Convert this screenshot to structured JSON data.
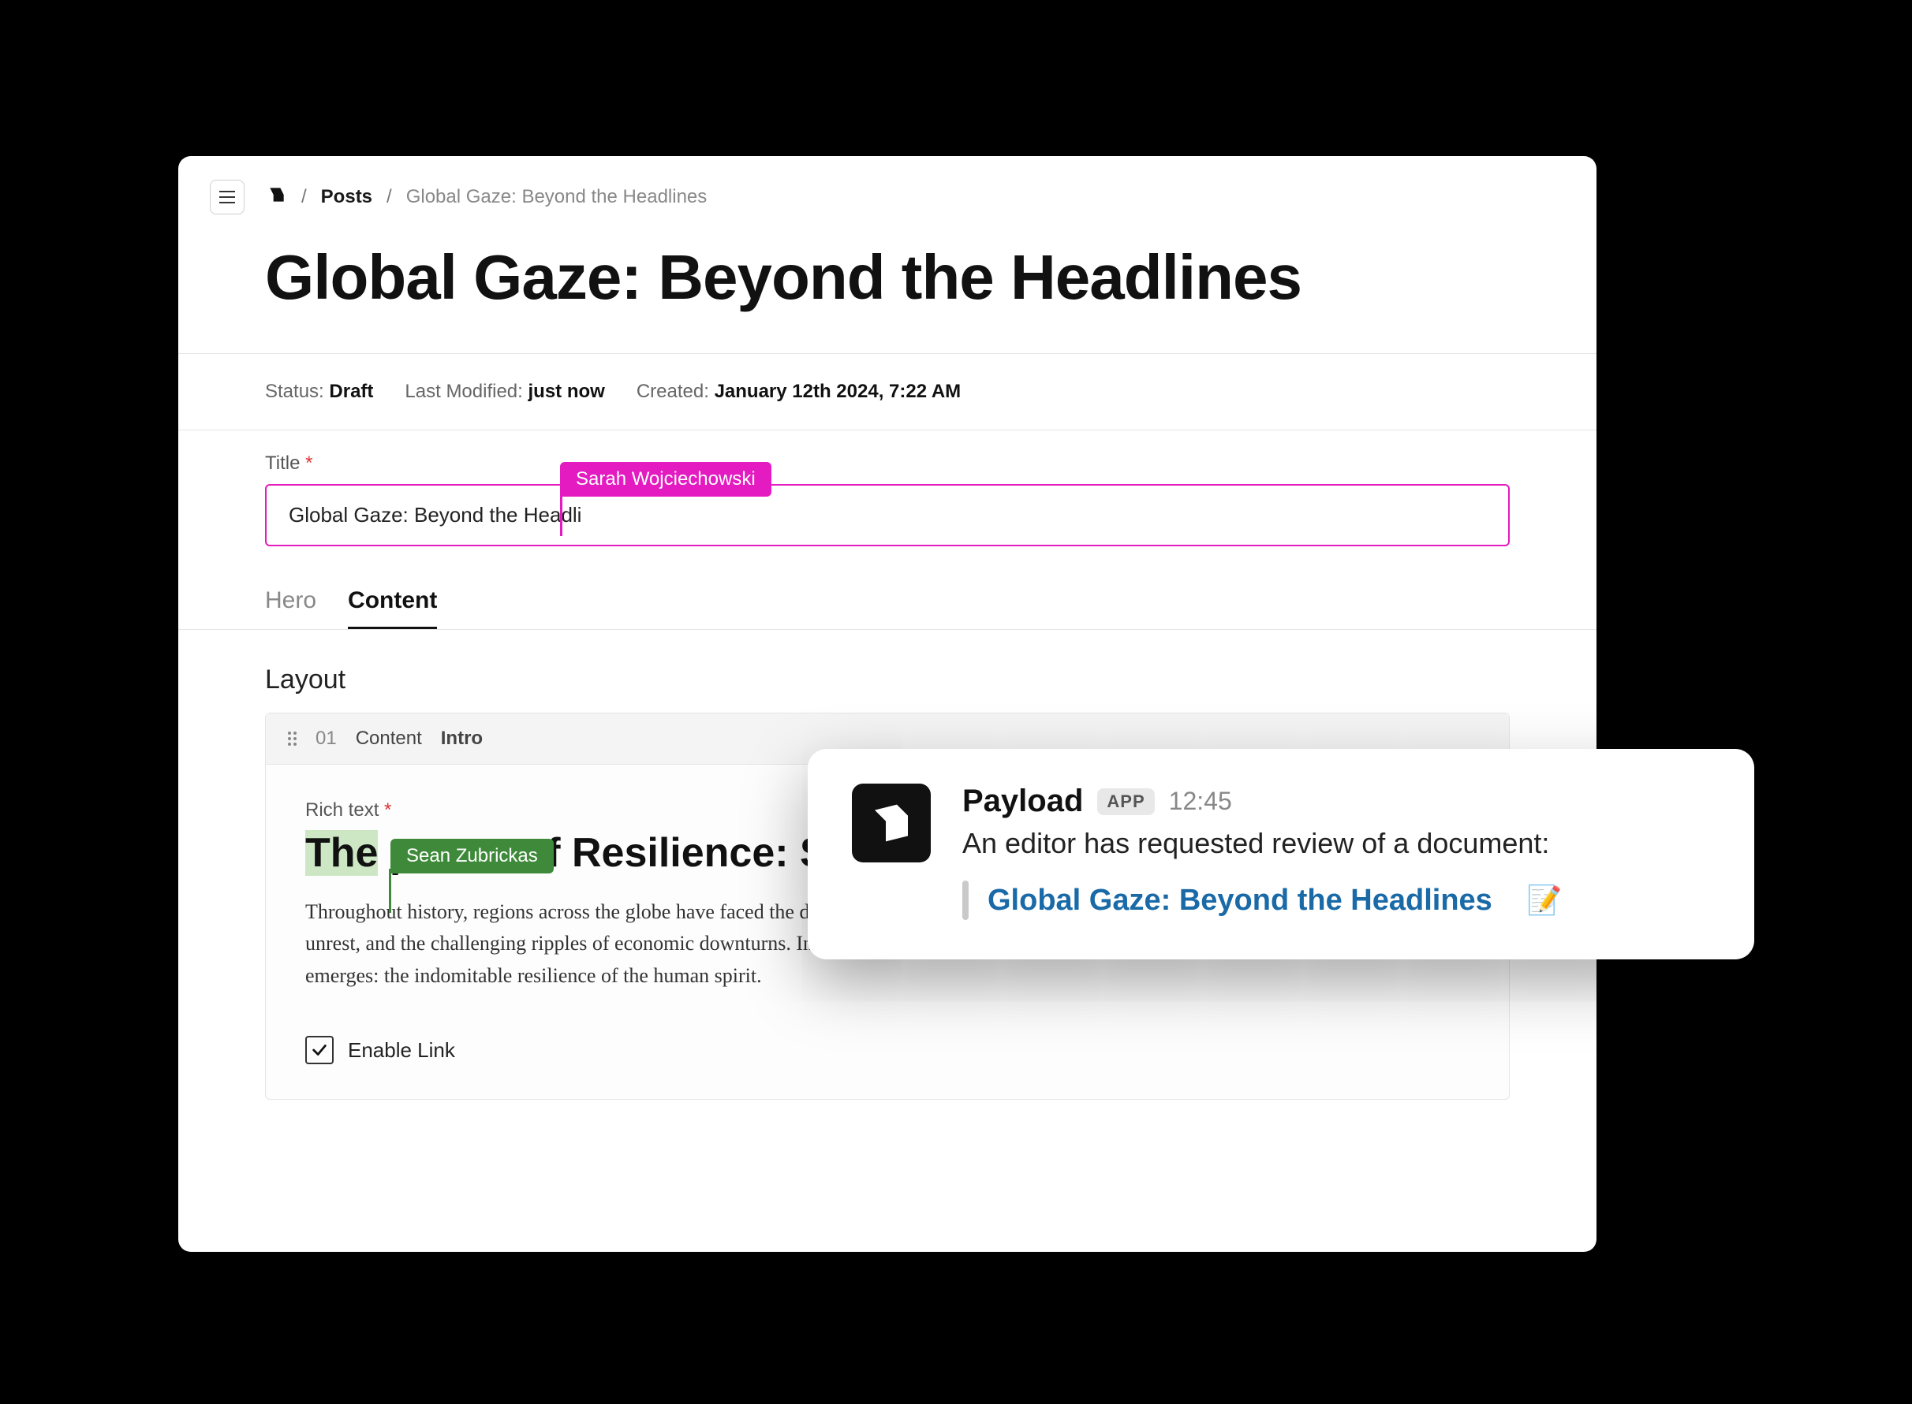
{
  "breadcrumbs": {
    "collection": "Posts",
    "current": "Global Gaze: Beyond the Headlines"
  },
  "page_title": "Global Gaze: Beyond the Headlines",
  "meta": {
    "status_label": "Status:",
    "status_value": "Draft",
    "modified_label": "Last Modified:",
    "modified_value": "just now",
    "created_label": "Created:",
    "created_value": "January 12th 2024, 7:22 AM"
  },
  "title_field": {
    "label": "Title",
    "value": "Global Gaze: Beyond the Headli",
    "collaborator": "Sarah Wojciechowski"
  },
  "tabs": {
    "hero": "Hero",
    "content": "Content"
  },
  "layout": {
    "heading": "Layout",
    "block": {
      "index": "01",
      "kind": "Content",
      "variant": "Intro",
      "richtext_label": "Rich text",
      "heading_highlight": "The",
      "heading_rest": " power of Resilience: Sto",
      "collaborator": "Sean Zubrickas",
      "paragraph": "Throughout history, regions across the globe have faced the devastating impact of natural disasters, the turbulence of political unrest, and the challenging ripples of economic downturns. In these moments of profound crisis, an often-underestimated force emerges: the indomitable resilience of the human spirit.",
      "enable_link_label": "Enable Link",
      "enable_link_checked": true
    }
  },
  "toast": {
    "app_name": "Payload",
    "badge": "APP",
    "time": "12:45",
    "message": "An editor has requested review of a document:",
    "link_text": "Global Gaze: Beyond the Headlines",
    "emoji": "📝"
  }
}
